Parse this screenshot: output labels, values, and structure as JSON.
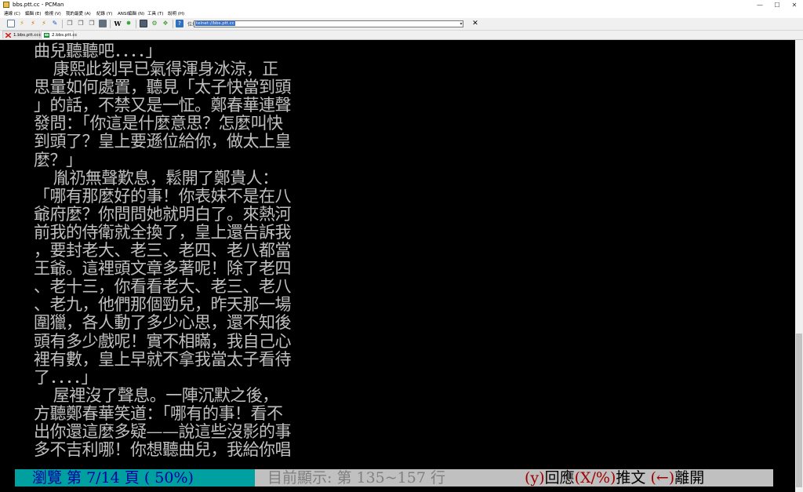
{
  "window": {
    "title": "bbs.ptt.cc - PCMan",
    "minimize": "—",
    "maximize": "☐",
    "close": "✕"
  },
  "menu": [
    "連線 (C)",
    "編輯 (E)",
    "檢視 (V)",
    "我的最愛 (A)",
    "紀錄 (Y)",
    "ANSI編輯 (N)",
    "工具 (T)",
    "說明 (H)"
  ],
  "toolbar": {
    "icons": [
      "new-connection-icon",
      "reconnect-icon",
      "disconnect-icon",
      "reconnect-all-icon",
      "pin-icon",
      "copy-icon",
      "paste-icon",
      "copy-ansi-icon",
      "paste-ansi-icon",
      "wikipedia-icon",
      "settings-gear-icon",
      "anti-idle-icon",
      "keyboard-icon",
      "favorites-icon",
      "search-icon"
    ],
    "wikipedia_glyph": "W",
    "address_label": "位址",
    "address_value": "telnet://bbs.ptt.cc",
    "close_glyph": "✕"
  },
  "tabs": [
    {
      "label": "1.bbs.ptt.ccc",
      "active": false
    },
    {
      "label": "2.bbs.ptt.cc",
      "active": true
    }
  ],
  "article_lines": [
    "曲兒聽聽吧．．．．」",
    "    康熙此刻早已氣得渾身冰涼，正",
    "思量如何處置，聽見「太子快當到頭",
    "」的話，不禁又是一怔。鄭春華連聲",
    "發問：「你這是什麼意思？怎麼叫快",
    "到頭了？皇上要遜位給你，做太上皇",
    "麼？」",
    "    胤礽無聲歎息，鬆開了鄭貴人：",
    "「哪有那麼好的事！你表妹不是在八",
    "爺府麼？你問問她就明白了。來熱河",
    "前我的侍衛就全換了，皇上還告訴我",
    "，要封老大、老三、老四、老八都當",
    "王爺。這裡頭文章多著呢！除了老四",
    "、老十三，你看看老大、老三、老八",
    "、老九，他們那個勁兒，昨天那一場",
    "圍獵，各人動了多少心思，還不知後",
    "頭有多少戲呢！實不相瞞，我自己心",
    "裡有數，皇上早就不拿我當太子看待",
    "了．．．．」",
    "    屋裡沒了聲息。一陣沉默之後，",
    "方聽鄭春華笑道：「哪有的事！看不",
    "出你還這麼多疑——說這些沒影的事",
    "多不吉利哪！你想聽曲兒，我給你唱"
  ],
  "status": {
    "browse": "瀏覽 第 7/14 頁 ( 50%)",
    "lines": "目前顯示: 第 135~157 行",
    "key_reply": "(y)",
    "label_reply": "回應",
    "key_push": "(X/%)",
    "label_push": "推文",
    "key_leave": "(←)",
    "label_leave": "離開"
  },
  "colors": {
    "terminal_bg": "#000000",
    "terminal_fg": "#c0c0c0",
    "status_bg": "#c0c0c0",
    "browse_bg": "#00a0a0",
    "browse_fg": "#0000a0",
    "key_fg": "#a00000"
  },
  "scroll_position": 0.5
}
